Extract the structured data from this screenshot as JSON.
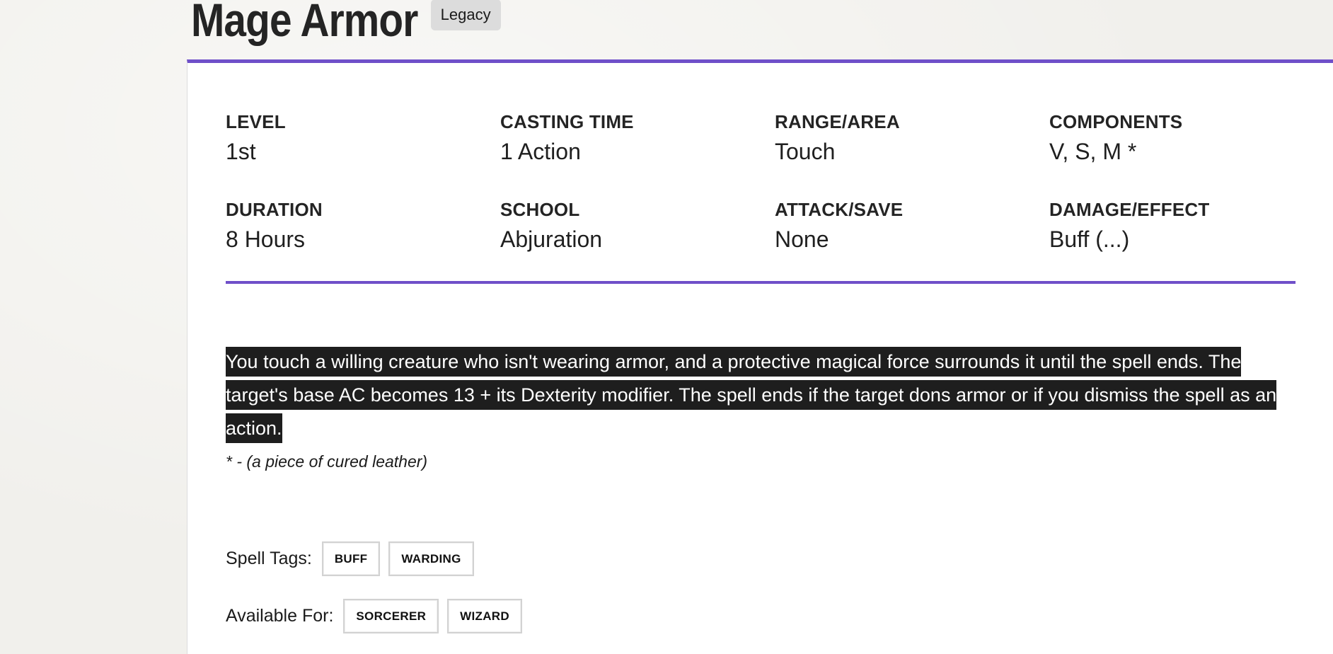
{
  "header": {
    "title": "Mage Armor",
    "badge": "Legacy"
  },
  "colors": {
    "accent": "#6f4fc9",
    "highlight_bg": "#1e1e1e"
  },
  "stats": {
    "level": {
      "label": "LEVEL",
      "value": "1st"
    },
    "casting_time": {
      "label": "CASTING TIME",
      "value": "1 Action"
    },
    "range": {
      "label": "RANGE/AREA",
      "value": "Touch"
    },
    "components": {
      "label": "COMPONENTS",
      "value": "V, S, M *"
    },
    "duration": {
      "label": "DURATION",
      "value": "8 Hours"
    },
    "school": {
      "label": "SCHOOL",
      "value": "Abjuration"
    },
    "attack_save": {
      "label": "ATTACK/SAVE",
      "value": "None"
    },
    "damage_effect": {
      "label": "DAMAGE/EFFECT",
      "value": "Buff (...)"
    }
  },
  "description": "You touch a willing creature who isn't wearing armor, and a protective magical force surrounds it until the spell ends. The target's base AC becomes 13 + its Dexterity modifier. The spell ends if the target dons armor or if you dismiss the spell as an action.",
  "footnote": "* - (a piece of cured leather)",
  "spell_tags": {
    "label": "Spell Tags:",
    "items": [
      "BUFF",
      "WARDING"
    ]
  },
  "available_for": {
    "label": "Available For:",
    "items": [
      "SORCERER",
      "WIZARD"
    ]
  }
}
